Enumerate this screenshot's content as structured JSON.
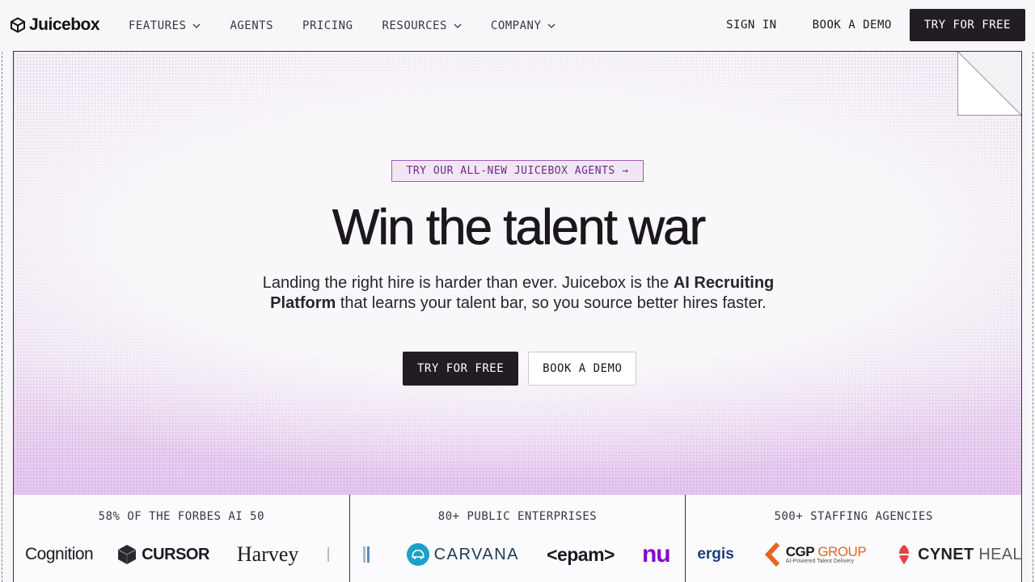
{
  "brand": {
    "name": "Juicebox"
  },
  "nav": {
    "menu": [
      {
        "label": "FEATURES",
        "has_dropdown": true
      },
      {
        "label": "AGENTS",
        "has_dropdown": false
      },
      {
        "label": "PRICING",
        "has_dropdown": false
      },
      {
        "label": "RESOURCES",
        "has_dropdown": true
      },
      {
        "label": "COMPANY",
        "has_dropdown": true
      }
    ],
    "sign_in": "SIGN IN",
    "book_demo": "BOOK A DEMO",
    "try_free": "TRY FOR FREE"
  },
  "hero": {
    "announcement": "TRY OUR ALL-NEW JUICEBOX AGENTS →",
    "headline": "Win the talent war",
    "sub_part1": "Landing the right hire is harder than ever. Juicebox is the ",
    "sub_bold": "AI Recruiting Platform",
    "sub_part2": " that learns your talent bar, so you source better hires faster.",
    "cta_primary": "TRY FOR FREE",
    "cta_secondary": "BOOK A DEMO"
  },
  "logo_strip": [
    {
      "title": "58% OF THE FORBES AI 50",
      "logos": [
        "Cognition",
        "CURSOR",
        "Harvey"
      ]
    },
    {
      "title": "80+ PUBLIC ENTERPRISES",
      "logos": [
        "CARVANA",
        "<epam>",
        "nu"
      ]
    },
    {
      "title": "500+ STAFFING AGENCIES",
      "logos": [
        "ergis",
        "CGP GROUP",
        "AI-Powered Talent Delivery",
        "CYNET HEALTH"
      ]
    }
  ],
  "colors": {
    "accent_purple": "#a05cb8",
    "dark": "#221c24",
    "carvana_blue": "#1aa2c7",
    "nu_purple": "#820ad1",
    "cgp_orange": "#e3661e",
    "cynet_red": "#e2434b"
  }
}
